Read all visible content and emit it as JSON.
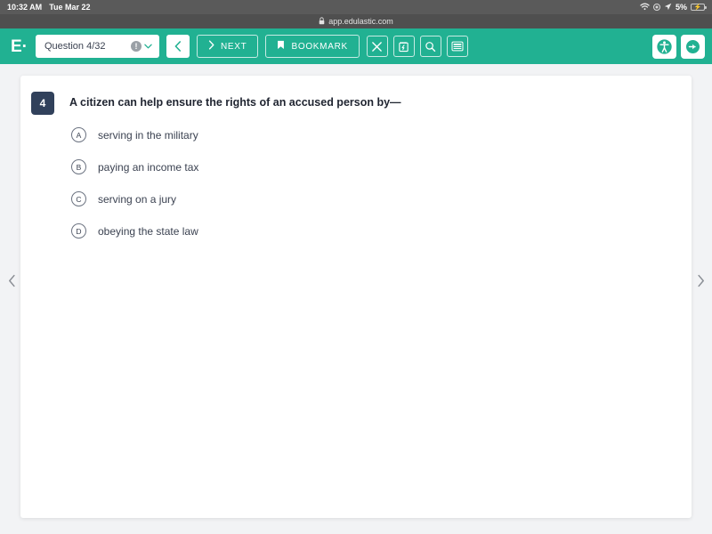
{
  "status_bar": {
    "time": "10:32 AM",
    "date": "Tue Mar 22",
    "wifi_icon": "wifi-icon",
    "record_icon": "screen-record-icon",
    "location_icon": "location-arrow-icon",
    "battery_percent": "5%",
    "battery_icon": "battery-charging-icon",
    "bolt_glyph": "⚡"
  },
  "browser": {
    "lock_icon": "lock-icon",
    "url": "app.edulastic.com"
  },
  "toolbar": {
    "brand": "E·",
    "question_selector": {
      "label": "Question 4/32",
      "info_icon": "info-icon",
      "info_glyph": "!",
      "chevron_icon": "chevron-down-icon"
    },
    "prev_button": {
      "icon": "chevron-left-icon",
      "glyph": "‹"
    },
    "next_button": {
      "label": "NEXT",
      "icon": "chevron-right-icon",
      "glyph": "›"
    },
    "bookmark_button": {
      "label": "BOOKMARK",
      "icon": "bookmark-icon"
    },
    "tools": [
      {
        "name": "cross-out-tool",
        "label": "Cross Out"
      },
      {
        "name": "scratchpad-tool",
        "label": "Scratchpad"
      },
      {
        "name": "magnify-tool",
        "label": "Magnify"
      },
      {
        "name": "line-reader-tool",
        "label": "Line Reader"
      }
    ],
    "accessibility_button": {
      "icon": "accessibility-icon"
    },
    "exit_button": {
      "icon": "exit-icon"
    }
  },
  "question": {
    "number": "4",
    "prompt": "A citizen can help ensure the rights of an accused person by—",
    "choices": [
      {
        "letter": "A",
        "text": "serving in the military"
      },
      {
        "letter": "B",
        "text": "paying an income tax"
      },
      {
        "letter": "C",
        "text": "serving on a jury"
      },
      {
        "letter": "D",
        "text": "obeying the state law"
      }
    ]
  },
  "navigation": {
    "prev_arrow": "‹",
    "next_arrow": "›"
  },
  "colors": {
    "brand_green": "#21b192",
    "badge_navy": "#31415b",
    "page_bg": "#f2f3f5",
    "status_bar_bg": "#5a5a5a",
    "url_bar_bg": "#4f4f4f"
  }
}
